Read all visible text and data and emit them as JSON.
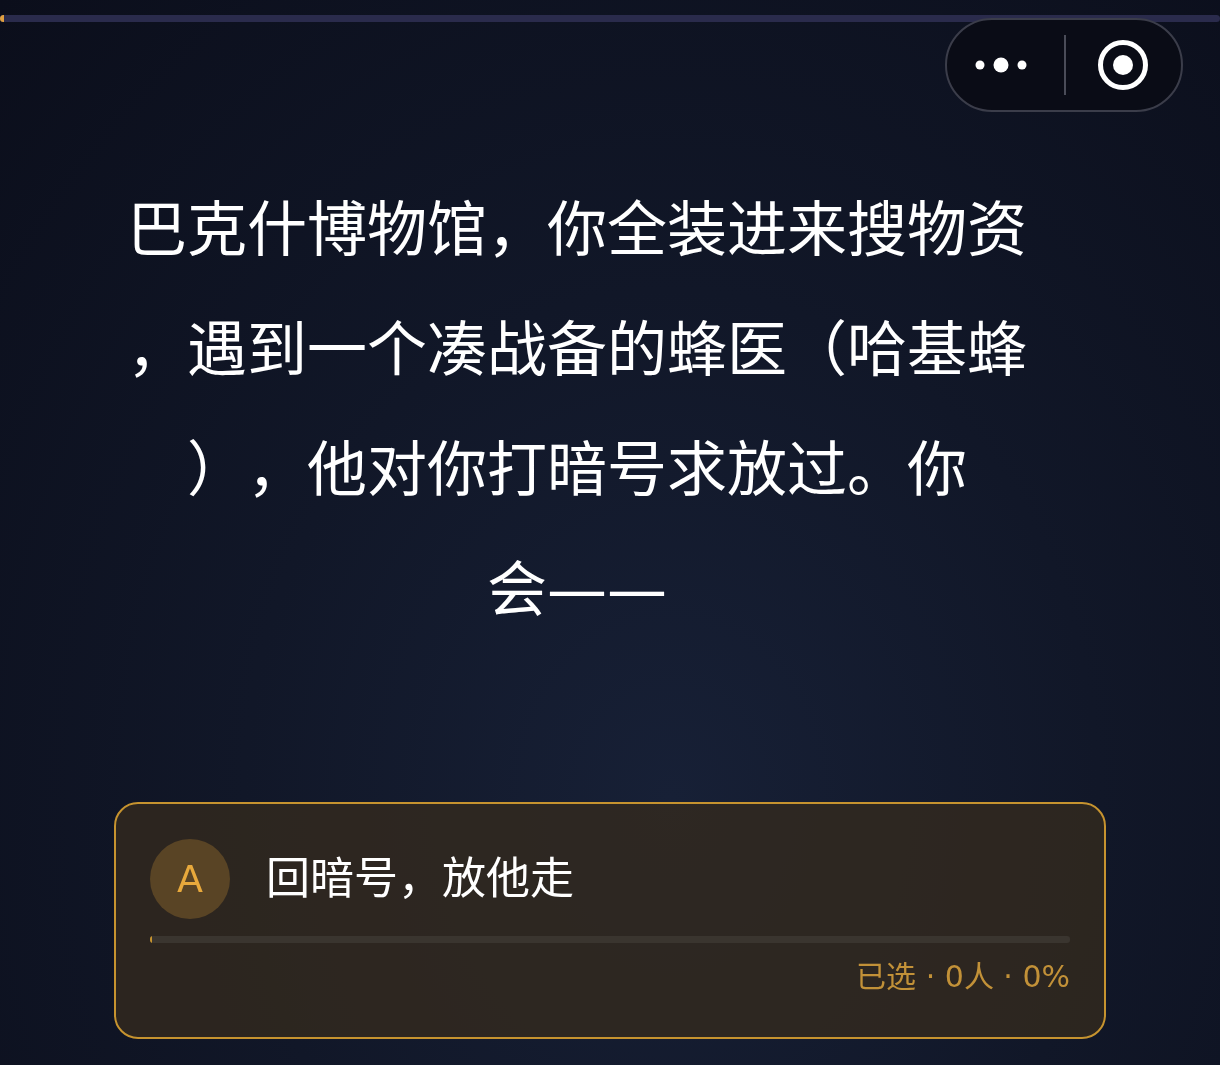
{
  "top_progress": {
    "level": 0.003
  },
  "question": "巴克什博物馆，你全装进来搜物资，遇到一个凑战备的蜂医（哈基蜂），他对你打暗号求放过。你会——",
  "options": [
    {
      "letter": "A",
      "text": "回暗号，放他走",
      "selected": false,
      "level": 0,
      "stats": "已选 · 0人 · 0%"
    }
  ]
}
